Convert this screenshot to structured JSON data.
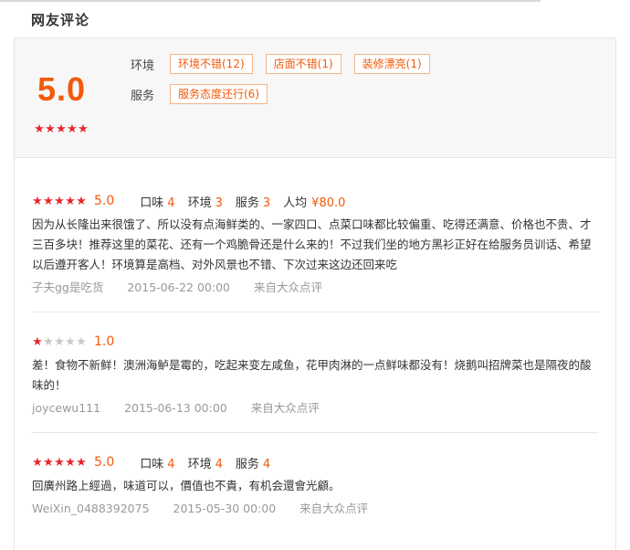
{
  "section_title": "网友评论",
  "summary": {
    "score": "5.0",
    "stars_on": 5,
    "tag_groups": [
      {
        "label": "环境",
        "tags": [
          "环境不错(12)",
          "店面不错(1)",
          "装修漂亮(1)"
        ]
      },
      {
        "label": "服务",
        "tags": [
          "服务态度还行(6)"
        ]
      }
    ]
  },
  "reviews": [
    {
      "stars_on": 5,
      "score": "5.0",
      "attrs": [
        {
          "k": "口味",
          "v": "4"
        },
        {
          "k": "环境",
          "v": "3"
        },
        {
          "k": "服务",
          "v": "3"
        }
      ],
      "price_label": "人均",
      "price": "¥80.0",
      "text": "因为从长隆出来很饿了、所以没有点海鲜类的、一家四口、点菜口味都比较偏重、吃得还满意、价格也不贵、才三百多块！推荐这里的菜花、还有一个鸡脆骨还是什么来的！不过我们坐的地方黑衫正好在给服务员训话、希望以后遵开客人！环境算是高档、对外风景也不错、下次过来这边还回来吃",
      "user": "子夫gg是吃货",
      "time": "2015-06-22 00:00",
      "source": "来自大众点评"
    },
    {
      "stars_on": 1,
      "score": "1.0",
      "attrs": [],
      "price_label": "",
      "price": "",
      "text": "差！食物不新鲜！澳洲海鲈是霉的，吃起来变左咸鱼，花甲肉淋的一点鲜味都没有！烧鹅叫招牌菜也是隔夜的酸味的！",
      "user": "joycewu111",
      "time": "2015-06-13 00:00",
      "source": "来自大众点评"
    },
    {
      "stars_on": 5,
      "score": "5.0",
      "attrs": [
        {
          "k": "口味",
          "v": "4"
        },
        {
          "k": "环境",
          "v": "4"
        },
        {
          "k": "服务",
          "v": "4"
        }
      ],
      "price_label": "",
      "price": "",
      "text": "回廣州路上經過，味道可以，價值也不貴，有机会還會光顧。",
      "user": "WeiXin_0488392075",
      "time": "2015-05-30 00:00",
      "source": "来自大众点评"
    }
  ],
  "colors": {
    "accent": "#f25a0b",
    "star": "#e8262d",
    "star_off": "#c8c8c8"
  }
}
